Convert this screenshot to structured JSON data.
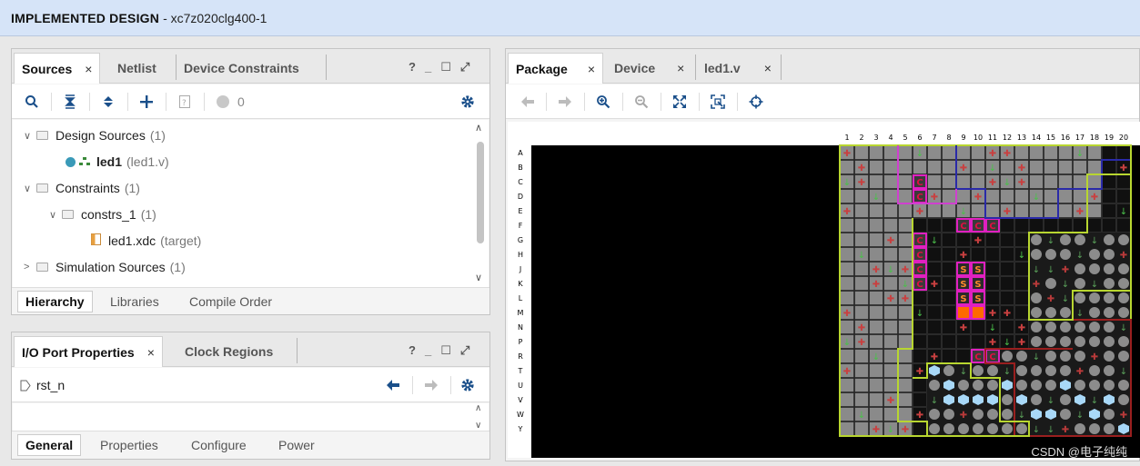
{
  "title": {
    "bold": "IMPLEMENTED DESIGN",
    "part": "- xc7z020clg400-1"
  },
  "sources": {
    "tabs": [
      {
        "label": "Sources",
        "close": "×"
      },
      {
        "label": "Netlist"
      },
      {
        "label": "Device Constraints"
      }
    ],
    "window_controls": [
      "?",
      "_",
      "☐",
      "⤢"
    ],
    "badge_count": "0",
    "tree": [
      {
        "label": "Design Sources",
        "count": "(1)"
      },
      {
        "label": "led1",
        "detail": "(led1.v)"
      },
      {
        "label": "Constraints",
        "count": "(1)"
      },
      {
        "label": "constrs_1",
        "count": "(1)"
      },
      {
        "label": "led1.xdc",
        "detail": "(target)"
      },
      {
        "label": "Simulation Sources",
        "count": "(1)"
      }
    ],
    "bottom_tabs": [
      "Hierarchy",
      "Libraries",
      "Compile Order"
    ]
  },
  "io": {
    "tabs": [
      {
        "label": "I/O Port Properties",
        "close": "×"
      },
      {
        "label": "Clock Regions"
      }
    ],
    "window_controls": [
      "?",
      "_",
      "☐",
      "⤢"
    ],
    "port": "rst_n",
    "bottom_tabs": [
      "General",
      "Properties",
      "Configure",
      "Power"
    ]
  },
  "package": {
    "tabs": [
      {
        "label": "Package",
        "close": "×"
      },
      {
        "label": "Device",
        "close": "×"
      },
      {
        "label": "led1.v",
        "close": "×"
      }
    ],
    "columns": [
      "1",
      "2",
      "3",
      "4",
      "5",
      "6",
      "7",
      "8",
      "9",
      "10",
      "11",
      "12",
      "13",
      "14",
      "15",
      "16",
      "17",
      "18",
      "19",
      "20"
    ],
    "rows": [
      "A",
      "B",
      "C",
      "D",
      "E",
      "F",
      "G",
      "H",
      "J",
      "K",
      "L",
      "M",
      "N",
      "P",
      "R",
      "T",
      "U",
      "V",
      "W",
      "Y"
    ],
    "colors": {
      "bank_outline": "#b8d630",
      "bank_blue": "#2a2aa8",
      "bank_pink": "#d040d0",
      "bank_red": "#9a1f1f",
      "clock_pin_border": "#e020c0",
      "clock_pin_text": "#e01040",
      "selected_pin": "#ff6a00",
      "light_pin": "#a8d8f8"
    },
    "pin_labels": {
      "clock": "C",
      "select": "S"
    }
  },
  "watermark": "CSDN @电子纯纯"
}
